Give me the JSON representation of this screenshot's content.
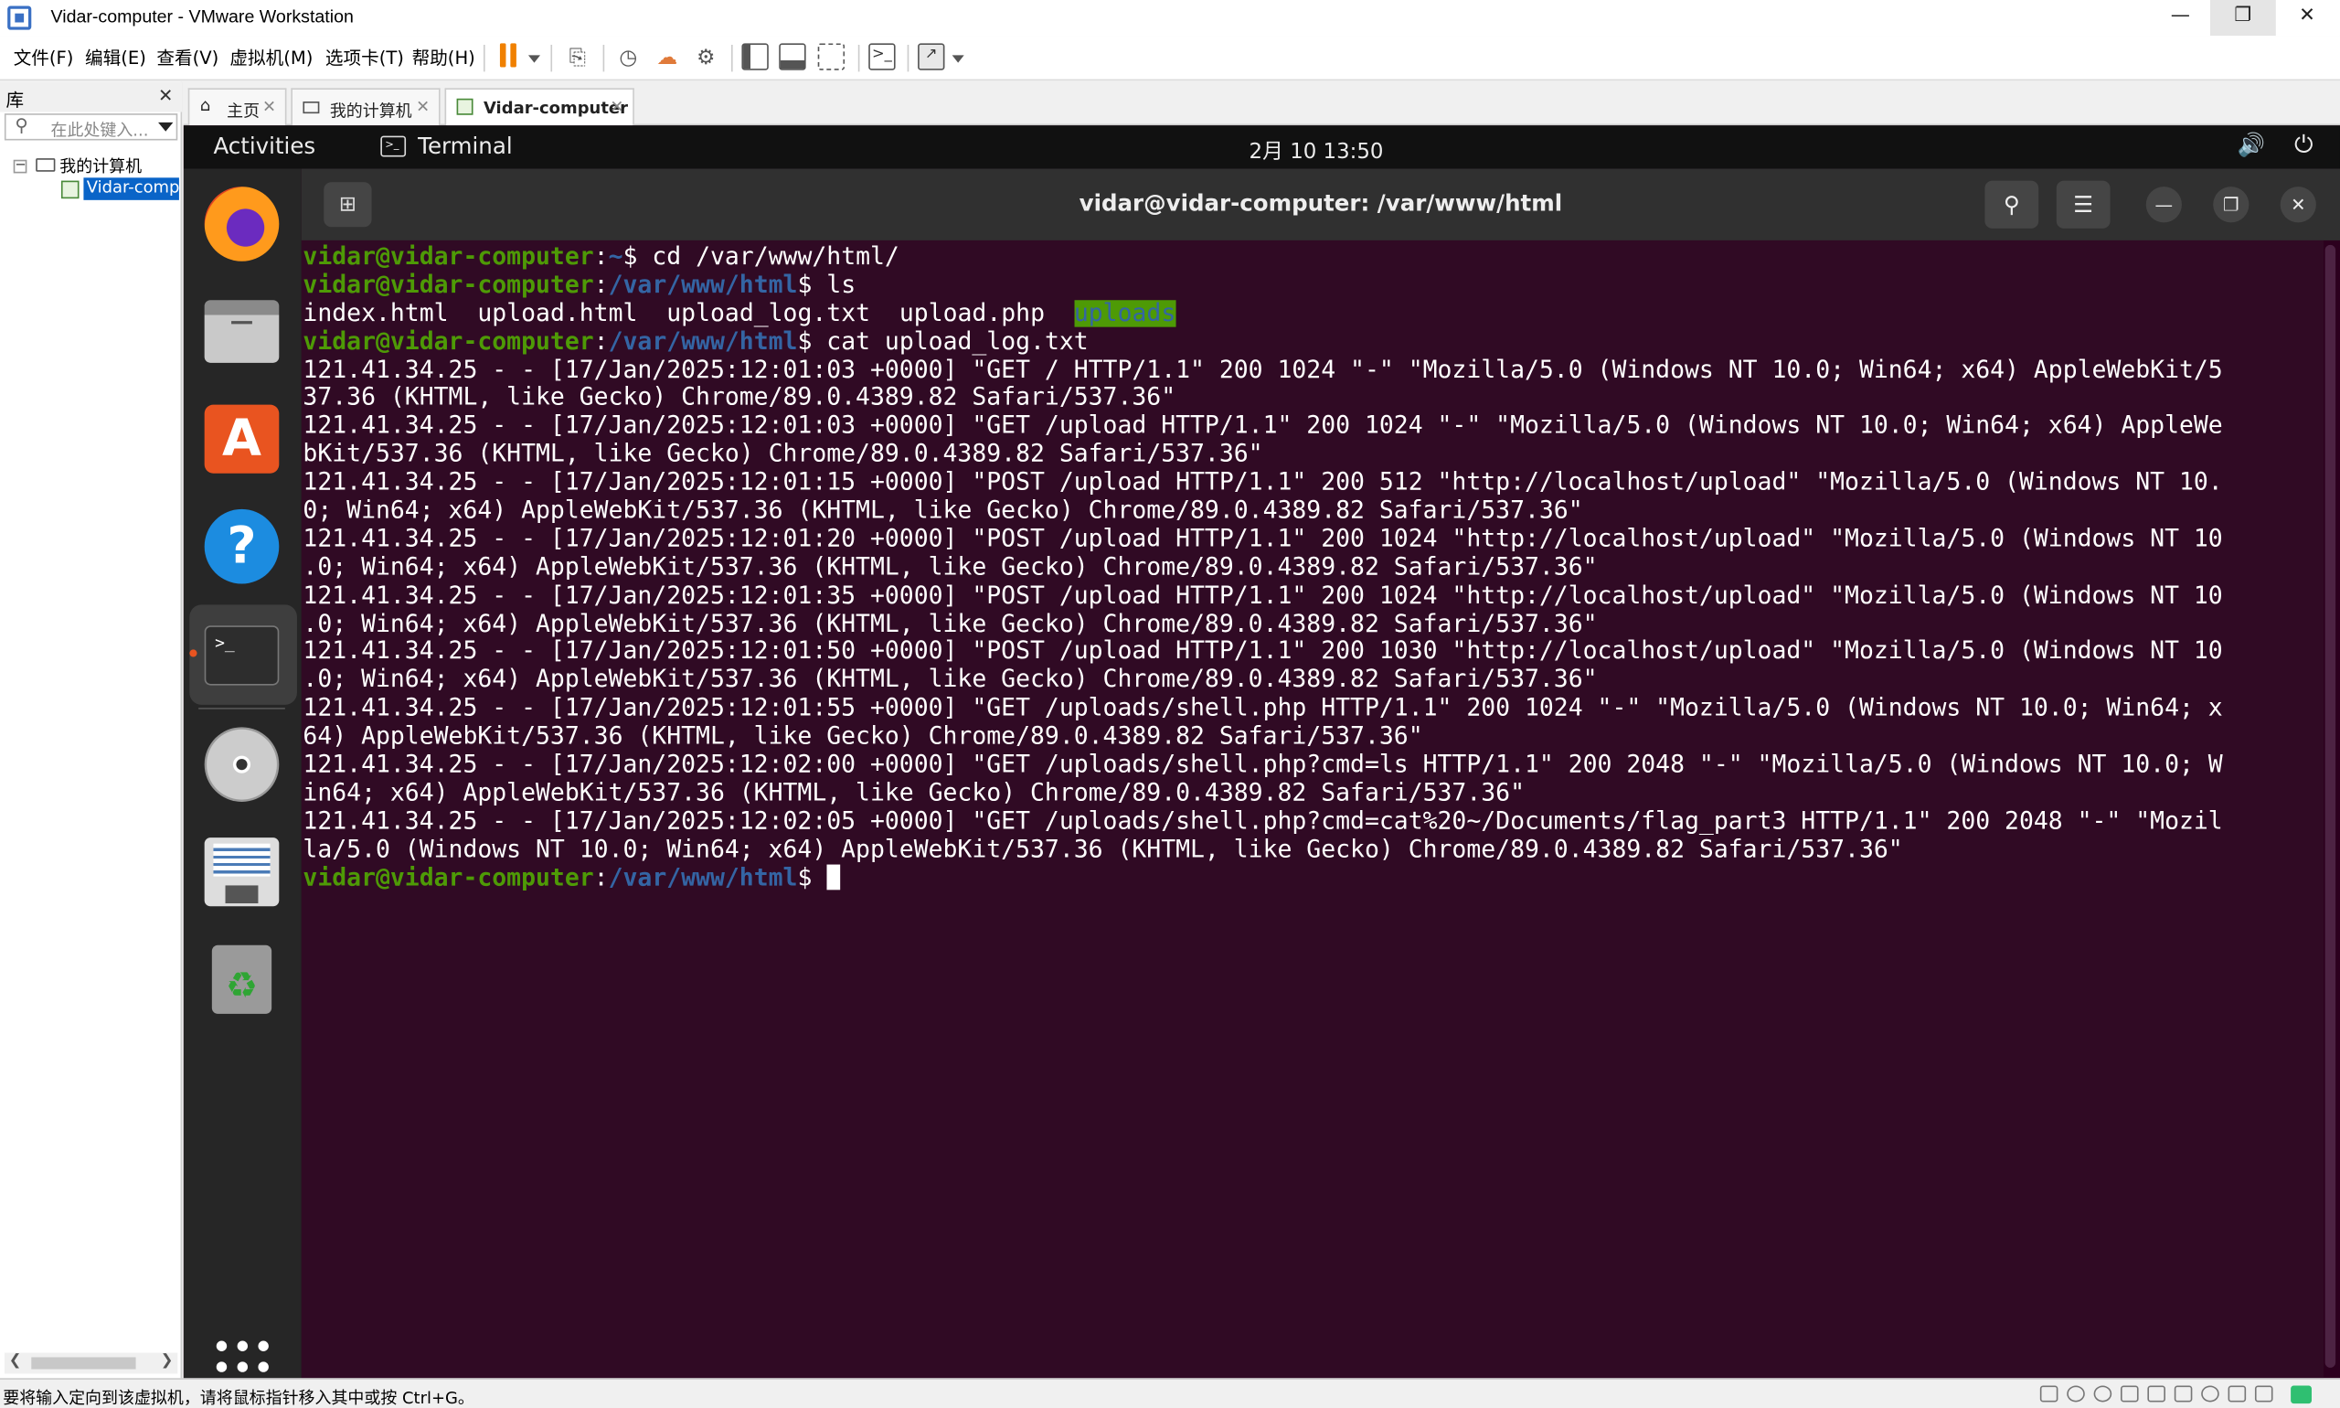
{
  "window": {
    "title": "Vidar-computer - VMware Workstation"
  },
  "menu": [
    "文件(F)",
    "编辑(E)",
    "查看(V)",
    "虚拟机(M)",
    "选项卡(T)",
    "帮助(H)"
  ],
  "library": {
    "title": "库",
    "search_placeholder": "在此处键入...",
    "tree_root": "我的计算机",
    "tree_vm": "Vidar-computer"
  },
  "tabs": [
    {
      "label": "主页",
      "icon": "home-icon",
      "active": false
    },
    {
      "label": "我的计算机",
      "icon": "computer-icon",
      "active": false
    },
    {
      "label": "Vidar-computer",
      "icon": "vm-icon",
      "active": true
    }
  ],
  "ubuntu": {
    "activities": "Activities",
    "app_name": "Terminal",
    "clock": "2月 10  13:50",
    "accent": "#e95420"
  },
  "terminal": {
    "title": "vidar@vidar-computer: /var/www/html",
    "prompt_user": "vidar@vidar-computer",
    "lines": [
      {
        "type": "prompt",
        "path": "~",
        "cmd": "cd /var/www/html/"
      },
      {
        "type": "prompt",
        "path": "/var/www/html",
        "cmd": "ls"
      },
      {
        "type": "ls",
        "files": [
          "index.html",
          "upload.html",
          "upload_log.txt",
          "upload.php"
        ],
        "dir": "uploads"
      },
      {
        "type": "prompt",
        "path": "/var/www/html",
        "cmd": "cat upload_log.txt"
      },
      {
        "type": "out",
        "text": "121.41.34.25 - - [17/Jan/2025:12:01:03 +0000] \"GET / HTTP/1.1\" 200 1024 \"-\" \"Mozilla/5.0 (Windows NT 10.0; Win64; x64) AppleWebKit/5"
      },
      {
        "type": "out",
        "text": "37.36 (KHTML, like Gecko) Chrome/89.0.4389.82 Safari/537.36\""
      },
      {
        "type": "out",
        "text": "121.41.34.25 - - [17/Jan/2025:12:01:03 +0000] \"GET /upload HTTP/1.1\" 200 1024 \"-\" \"Mozilla/5.0 (Windows NT 10.0; Win64; x64) AppleWe"
      },
      {
        "type": "out",
        "text": "bKit/537.36 (KHTML, like Gecko) Chrome/89.0.4389.82 Safari/537.36\""
      },
      {
        "type": "out",
        "text": "121.41.34.25 - - [17/Jan/2025:12:01:15 +0000] \"POST /upload HTTP/1.1\" 200 512 \"http://localhost/upload\" \"Mozilla/5.0 (Windows NT 10."
      },
      {
        "type": "out",
        "text": "0; Win64; x64) AppleWebKit/537.36 (KHTML, like Gecko) Chrome/89.0.4389.82 Safari/537.36\""
      },
      {
        "type": "out",
        "text": "121.41.34.25 - - [17/Jan/2025:12:01:20 +0000] \"POST /upload HTTP/1.1\" 200 1024 \"http://localhost/upload\" \"Mozilla/5.0 (Windows NT 10"
      },
      {
        "type": "out",
        "text": ".0; Win64; x64) AppleWebKit/537.36 (KHTML, like Gecko) Chrome/89.0.4389.82 Safari/537.36\""
      },
      {
        "type": "out",
        "text": "121.41.34.25 - - [17/Jan/2025:12:01:35 +0000] \"POST /upload HTTP/1.1\" 200 1024 \"http://localhost/upload\" \"Mozilla/5.0 (Windows NT 10"
      },
      {
        "type": "out",
        "text": ".0; Win64; x64) AppleWebKit/537.36 (KHTML, like Gecko) Chrome/89.0.4389.82 Safari/537.36\""
      },
      {
        "type": "out",
        "text": "121.41.34.25 - - [17/Jan/2025:12:01:50 +0000] \"POST /upload HTTP/1.1\" 200 1030 \"http://localhost/upload\" \"Mozilla/5.0 (Windows NT 10"
      },
      {
        "type": "out",
        "text": ".0; Win64; x64) AppleWebKit/537.36 (KHTML, like Gecko) Chrome/89.0.4389.82 Safari/537.36\""
      },
      {
        "type": "out",
        "text": "121.41.34.25 - - [17/Jan/2025:12:01:55 +0000] \"GET /uploads/shell.php HTTP/1.1\" 200 1024 \"-\" \"Mozilla/5.0 (Windows NT 10.0; Win64; x"
      },
      {
        "type": "out",
        "text": "64) AppleWebKit/537.36 (KHTML, like Gecko) Chrome/89.0.4389.82 Safari/537.36\""
      },
      {
        "type": "out",
        "text": "121.41.34.25 - - [17/Jan/2025:12:02:00 +0000] \"GET /uploads/shell.php?cmd=ls HTTP/1.1\" 200 2048 \"-\" \"Mozilla/5.0 (Windows NT 10.0; W"
      },
      {
        "type": "out",
        "text": "in64; x64) AppleWebKit/537.36 (KHTML, like Gecko) Chrome/89.0.4389.82 Safari/537.36\""
      },
      {
        "type": "out",
        "text": "121.41.34.25 - - [17/Jan/2025:12:02:05 +0000] \"GET /uploads/shell.php?cmd=cat%20~/Documents/flag_part3 HTTP/1.1\" 200 2048 \"-\" \"Mozil"
      },
      {
        "type": "out",
        "text": "la/5.0 (Windows NT 10.0; Win64; x64) AppleWebKit/537.36 (KHTML, like Gecko) Chrome/89.0.4389.82 Safari/537.36\""
      },
      {
        "type": "prompt",
        "path": "/var/www/html",
        "cmd": "",
        "cursor": true
      }
    ],
    "colors": {
      "background": "#300a24",
      "user": "#4e9a06",
      "path": "#3465a4"
    }
  },
  "statusbar": {
    "text": "要将输入定向到该虚拟机，请将鼠标指针移入其中或按 Ctrl+G。"
  }
}
